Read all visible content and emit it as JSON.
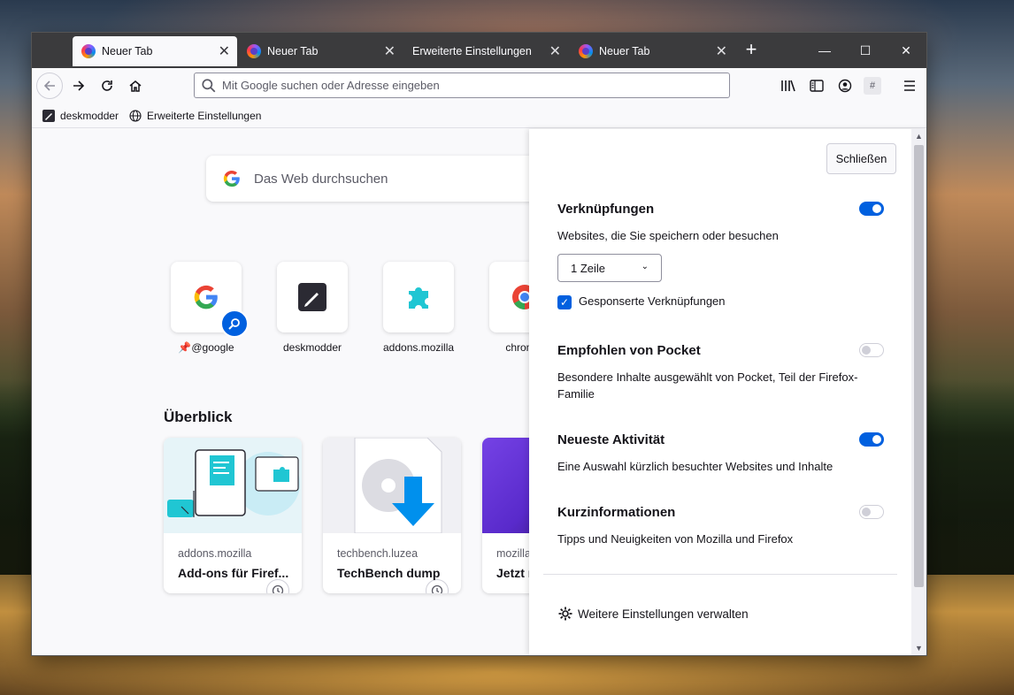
{
  "tabs": [
    {
      "label": "Neuer Tab",
      "active": true
    },
    {
      "label": "Neuer Tab",
      "active": false
    },
    {
      "label": "Erweiterte Einstellungen",
      "active": false
    },
    {
      "label": "Neuer Tab",
      "active": false
    }
  ],
  "urlbar": {
    "placeholder": "Mit Google suchen oder Adresse eingeben",
    "value": ""
  },
  "bookmarks": [
    {
      "label": "deskmodder"
    },
    {
      "label": "Erweiterte Einstellungen"
    }
  ],
  "search": {
    "placeholder": "Das Web durchsuchen"
  },
  "topsites": [
    {
      "label": "@google"
    },
    {
      "label": "deskmodder"
    },
    {
      "label": "addons.mozilla"
    },
    {
      "label": "chrome."
    }
  ],
  "overview": {
    "title": "Überblick",
    "cards": [
      {
        "source": "addons.mozilla",
        "title": "Add-ons für Firef..."
      },
      {
        "source": "techbench.luzea",
        "title": "TechBench dump"
      },
      {
        "source": "mozilla",
        "title": "Jetzt r"
      }
    ]
  },
  "panel": {
    "close_label": "Schließen",
    "shortcuts": {
      "title": "Verknüpfungen",
      "desc": "Websites, die Sie speichern oder besuchen",
      "enabled": true,
      "rows_value": "1 Zeile",
      "sponsored_label": "Gesponserte Verknüpfungen",
      "sponsored_checked": true
    },
    "pocket": {
      "title": "Empfohlen von Pocket",
      "desc": "Besondere Inhalte ausgewählt von Pocket, Teil der Firefox-Familie",
      "enabled": false
    },
    "activity": {
      "title": "Neueste Aktivität",
      "desc": "Eine Auswahl kürzlich besuchter Websites und Inhalte",
      "enabled": true
    },
    "snippets": {
      "title": "Kurzinformationen",
      "desc": "Tipps und Neuigkeiten von Mozilla und Firefox",
      "enabled": false
    },
    "manage_label": "Weitere Einstellungen verwalten"
  },
  "colors": {
    "accent": "#0060df",
    "tabbar": "#3b3b3d",
    "page": "#f9f9fb"
  }
}
